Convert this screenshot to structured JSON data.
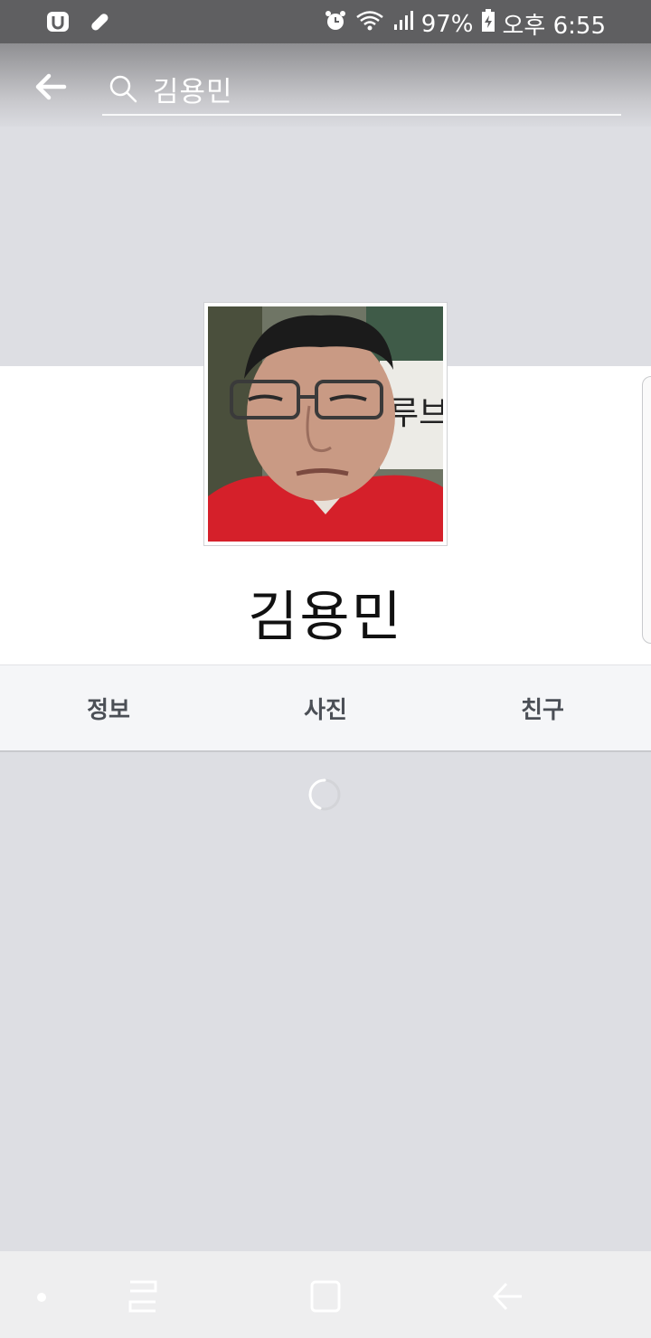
{
  "status_bar": {
    "battery": "97%",
    "time": "오후 6:55",
    "icons": [
      "app-u-icon",
      "pill-icon",
      "alarm-icon",
      "wifi-icon",
      "signal-icon",
      "battery-charging-icon"
    ]
  },
  "search": {
    "query": "김용민",
    "icon": "search-icon"
  },
  "profile": {
    "name": "김용민",
    "photo_sign_text": "루브"
  },
  "tabs": [
    {
      "label": "정보"
    },
    {
      "label": "사진"
    },
    {
      "label": "친구"
    }
  ],
  "nav_bar": {
    "items": [
      "dot-icon",
      "recent-apps-icon",
      "home-icon",
      "back-icon"
    ]
  },
  "colors": {
    "status_bar": "#5f5f61",
    "background": "#dddee3",
    "tab_bar": "#f5f6f8",
    "tab_text": "#4b4f56"
  }
}
